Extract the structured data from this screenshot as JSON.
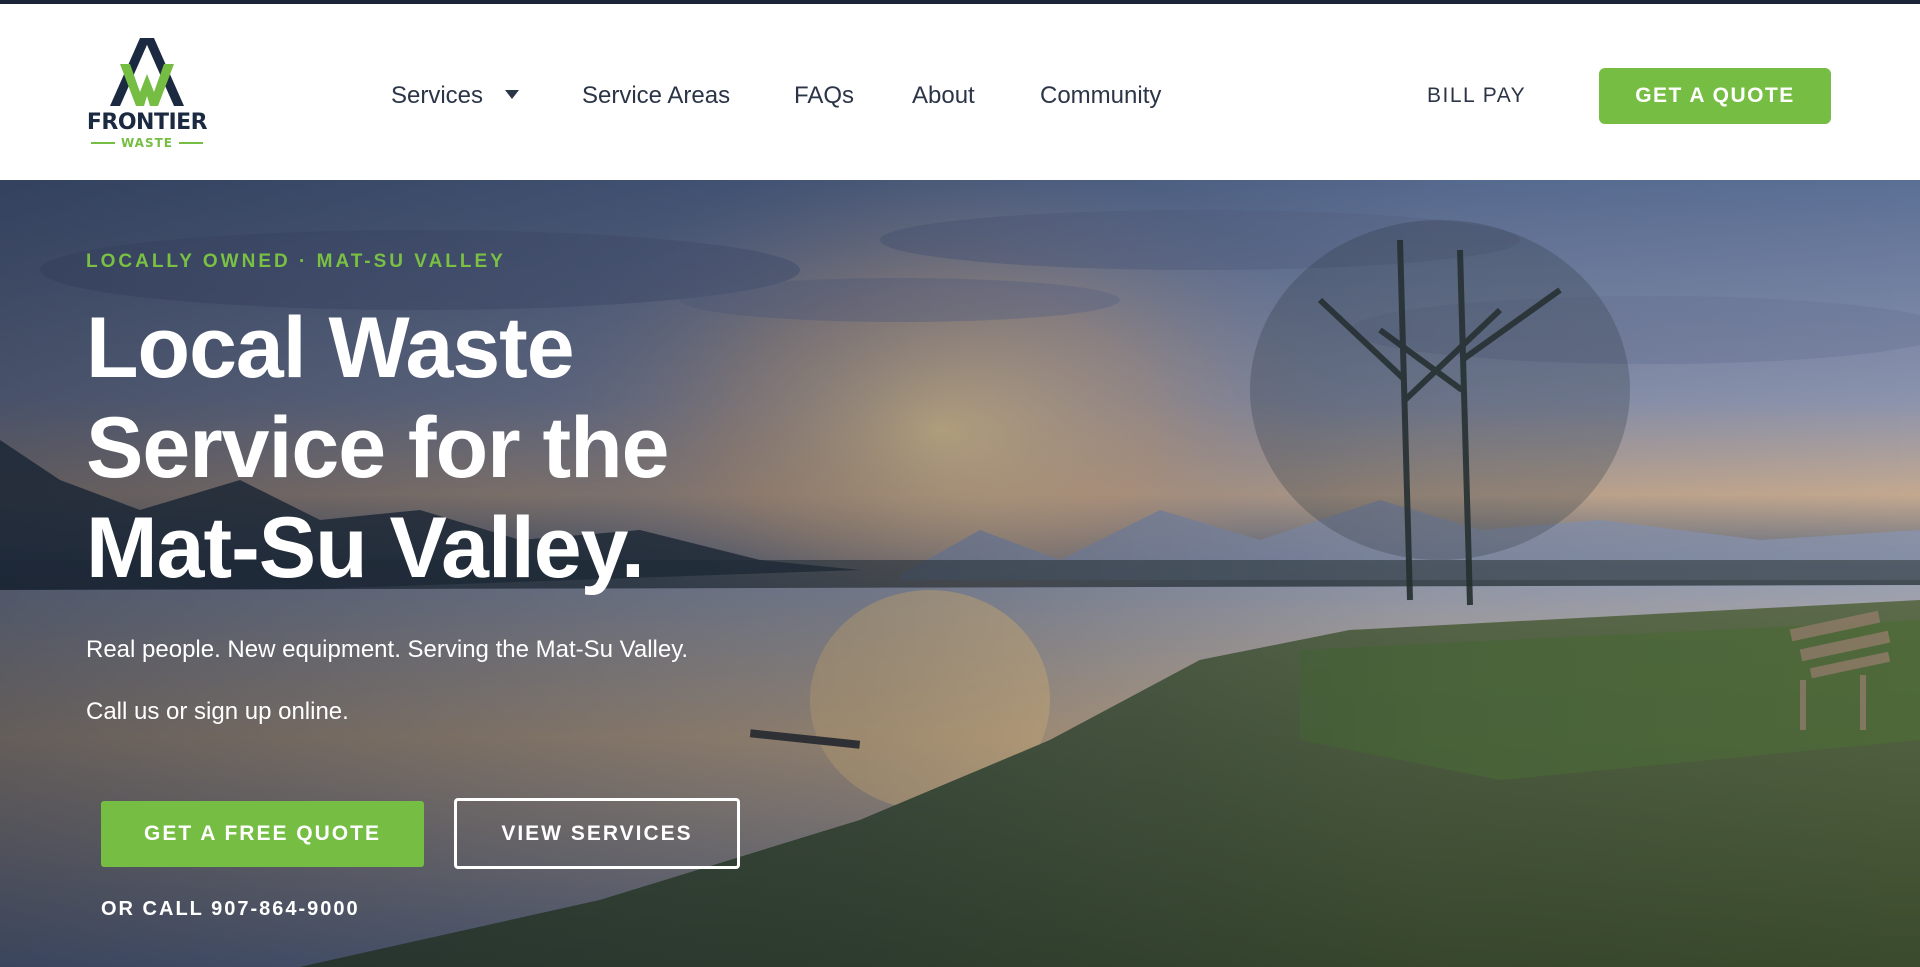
{
  "brand": {
    "name": "FRONTIER",
    "sub": "WASTE",
    "logo_icon": "frontier-mountain-logo",
    "colors": {
      "navy": "#1b2a40",
      "green": "#76bd43"
    }
  },
  "nav": {
    "items": [
      {
        "label": "Services",
        "has_dropdown": true
      },
      {
        "label": "Service Areas"
      },
      {
        "label": "FAQs"
      },
      {
        "label": "About"
      },
      {
        "label": "Community"
      }
    ],
    "bill_pay": "BILL PAY",
    "quote_button": "GET A QUOTE"
  },
  "hero": {
    "eyebrow": "LOCALLY OWNED · MAT-SU VALLEY",
    "headline": [
      "Local Waste",
      "Service for the",
      "Mat-Su Valley."
    ],
    "sub1": "Real people. New equipment. Serving the Mat-Su Valley.",
    "sub2": "Call us or sign up online.",
    "primary_button": "GET A FREE QUOTE",
    "secondary_button": "VIEW SERVICES",
    "call_text": "OR CALL 907-864-9000"
  }
}
